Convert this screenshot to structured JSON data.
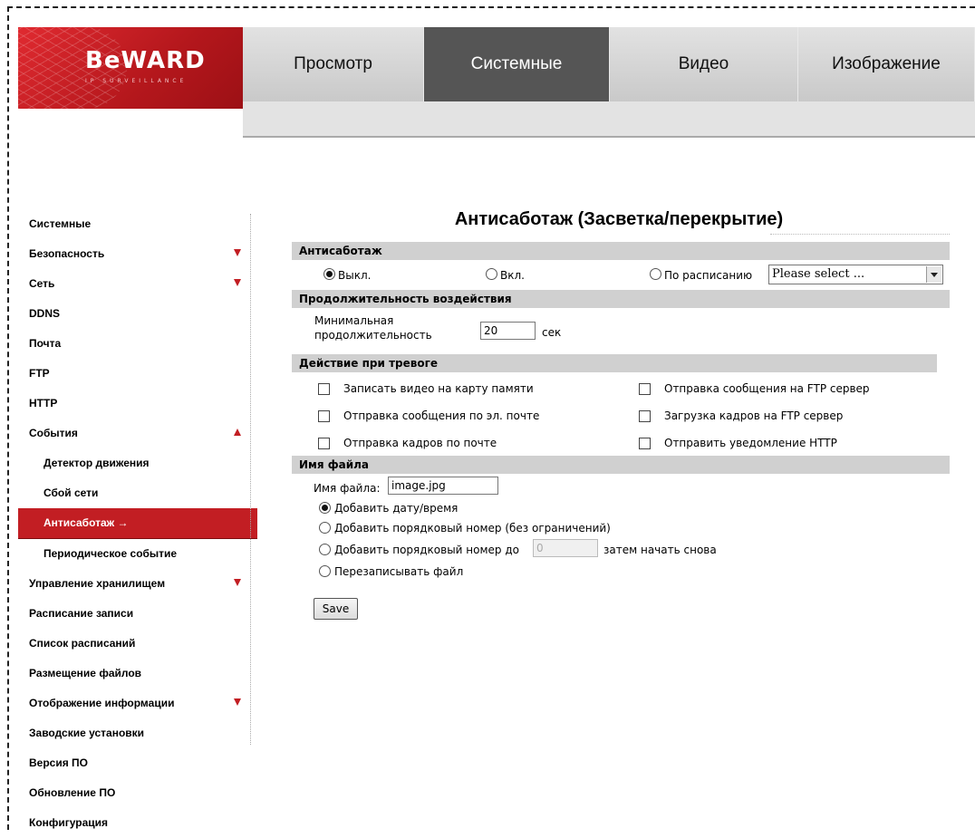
{
  "logo": {
    "brand": "BeWARD",
    "tagline": "IP SURVEILLANCE"
  },
  "topnav": {
    "tabs": [
      {
        "label": "Просмотр",
        "active": false
      },
      {
        "label": "Системные",
        "active": true
      },
      {
        "label": "Видео",
        "active": false
      },
      {
        "label": "Изображение",
        "active": false
      }
    ]
  },
  "sidebar": {
    "items": [
      {
        "label": "Системные"
      },
      {
        "label": "Безопасность",
        "arrow": "down"
      },
      {
        "label": "Сеть",
        "arrow": "down"
      },
      {
        "label": "DDNS"
      },
      {
        "label": "Почта"
      },
      {
        "label": "FTP"
      },
      {
        "label": "HTTP"
      },
      {
        "label": "События",
        "arrow": "up"
      },
      {
        "label": "Детектор движения",
        "sub": true
      },
      {
        "label": "Сбой сети",
        "sub": true
      },
      {
        "label": "Антисаботаж →",
        "sub": true,
        "active": true
      },
      {
        "label": "Периодическое событие",
        "sub": true
      },
      {
        "label": "Управление хранилищем",
        "arrow": "down"
      },
      {
        "label": "Расписание записи"
      },
      {
        "label": "Список расписаний"
      },
      {
        "label": "Размещение файлов"
      },
      {
        "label": "Отображение информации",
        "arrow": "down"
      },
      {
        "label": "Заводские установки"
      },
      {
        "label": "Версия ПО"
      },
      {
        "label": "Обновление ПО"
      },
      {
        "label": "Конфигурация"
      }
    ]
  },
  "page_title": "Антисаботаж (Засветка/перекрытие)",
  "antisabotage": {
    "header": "Антисаботаж",
    "off_label": "Выкл.",
    "on_label": "Вкл.",
    "schedule_label": "По расписанию",
    "schedule_select": "Please select ...",
    "selected": "off"
  },
  "duration": {
    "header": "Продолжительность воздействия",
    "label_line1": "Минимальная",
    "label_line2": "продолжительность",
    "value": "20",
    "unit": "сек"
  },
  "alarm_action": {
    "header": "Действие при тревоге",
    "record_sd": "Записать видео на карту памяти",
    "email_msg": "Отправка сообщения по эл. почте",
    "email_frames": "Отправка кадров по почте",
    "ftp_msg": "Отправка сообщения на FTP сервер",
    "ftp_frames": "Загрузка кадров на FTP сервер",
    "http_notify": "Отправить уведомление HTTP"
  },
  "filename": {
    "header": "Имя файла",
    "label": "Имя файла:",
    "value": "image.jpg",
    "opt_datetime": "Добавить дату/время",
    "opt_seq_unlimited": "Добавить порядковый номер (без ограничений)",
    "opt_seq_upto": "Добавить порядковый номер до",
    "seq_max_placeholder": "0",
    "opt_seq_suffix": "затем начать снова",
    "opt_overwrite": "Перезаписывать файл",
    "selected": "datetime"
  },
  "save_label": "Save",
  "colors": {
    "brand_red": "#c21e23",
    "active_tab": "#555555",
    "section_bg": "#d0d0d0"
  }
}
